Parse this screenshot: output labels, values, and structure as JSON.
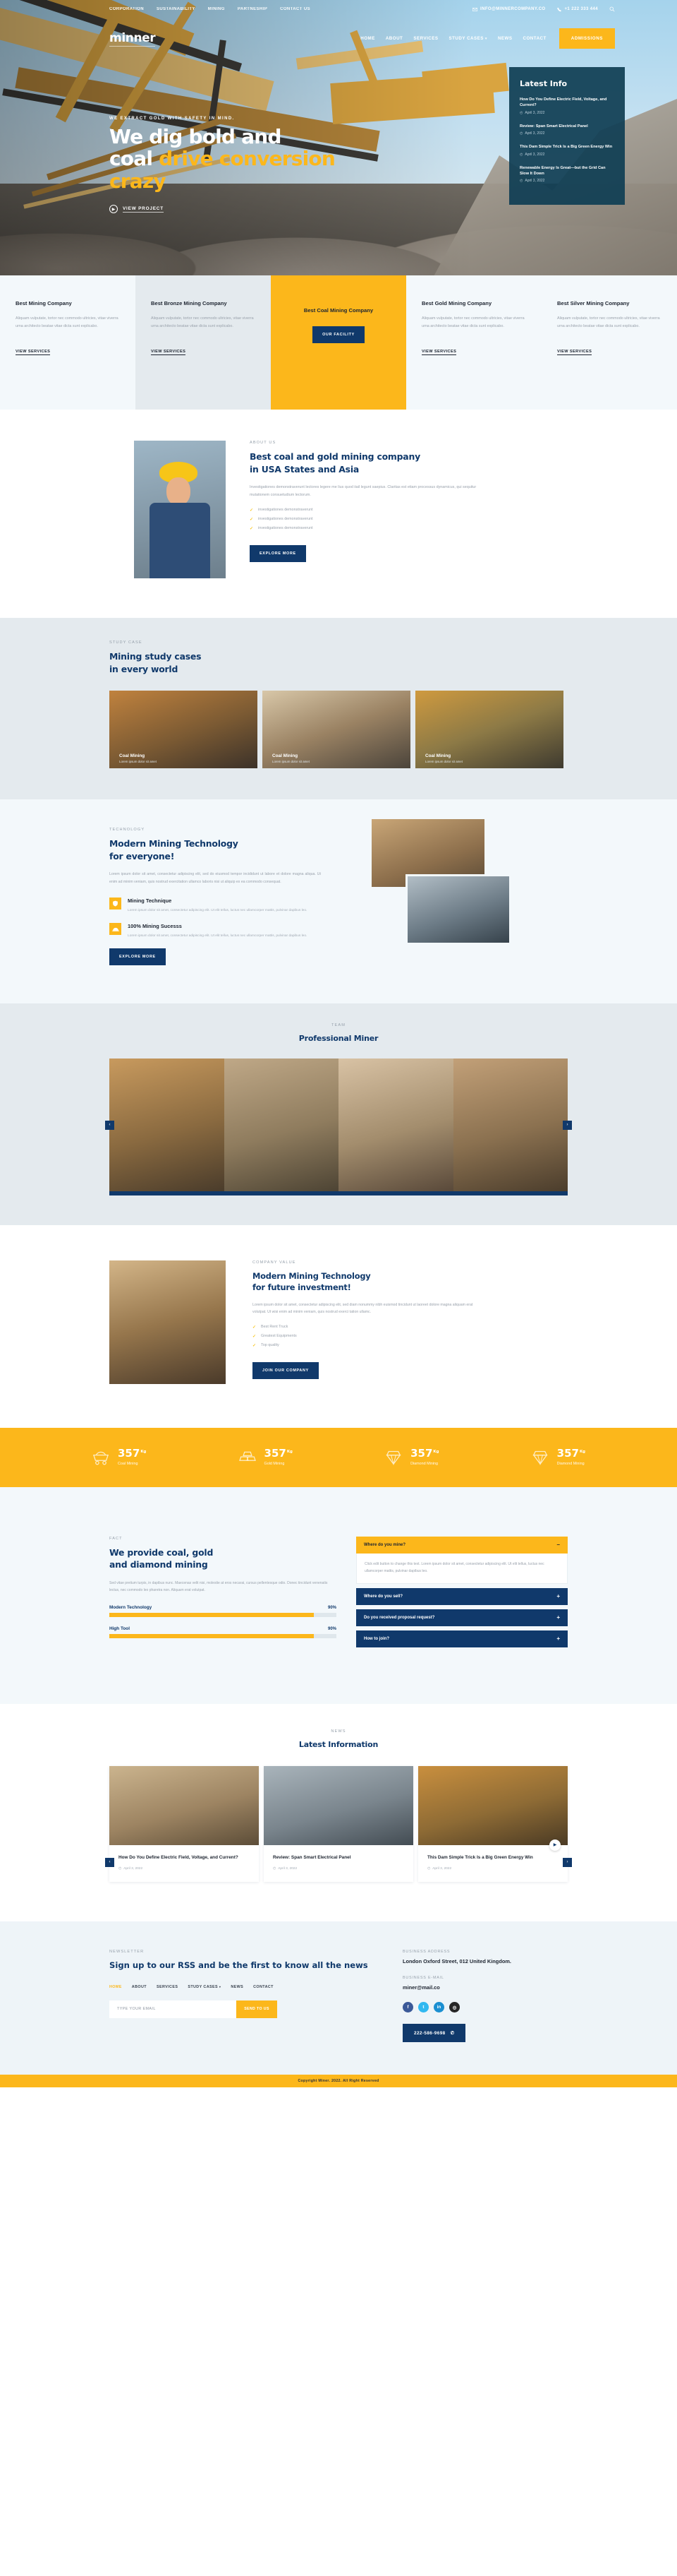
{
  "brand": {
    "name": "minner"
  },
  "topbar": {
    "links": [
      "CORPORATION",
      "SUSTAINABILITY",
      "MINING",
      "PARTNESHIP",
      "CONTACT US"
    ],
    "email": "INFO@MINNERCOMPANY.CO",
    "phone": "+1 222 333 444",
    "search_icon": "search-icon",
    "mail_icon": "mail-icon",
    "phone_icon": "phone-icon"
  },
  "nav": {
    "items": [
      "HOME",
      "ABOUT",
      "SERVICES",
      "STUDY CASES",
      "NEWS",
      "CONTACT"
    ],
    "dropdown_index": 3,
    "cta": "ADMISSIONS"
  },
  "hero": {
    "eyebrow": "WE EXTRACT GOLD WITH SAFETY IN MIND.",
    "title_1": "We dig bold and",
    "title_2a": "coal ",
    "title_2b": "drive conversion",
    "title_3": "crazy",
    "cta": "VIEW PROJECT"
  },
  "latest_info": {
    "title": "Latest Info",
    "items": [
      {
        "title": "How Do You Define Electric Field, Voltage, and Current?",
        "date": "April 3, 2022"
      },
      {
        "title": "Review: Span Smart Electrical Panel",
        "date": "April 3, 2022"
      },
      {
        "title": "This Dam Simple Trick Is a Big Green Energy Win",
        "date": "April 3, 2022"
      },
      {
        "title": "Renewable Energy Is Great—but the Grid Can Slow It Down",
        "date": "April 3, 2022"
      }
    ]
  },
  "service_cards": {
    "body": "Aliquam vulputate, tortor nec commodo ultricies, vitae viverra urna architecto beatae vitae dicta sunt explicabo.",
    "link": "VIEW SERVICES",
    "items": [
      {
        "title": "Best Mining Company"
      },
      {
        "title": "Best Bronze Mining Company"
      },
      {
        "title": "Best Coal Mining Company",
        "button": "OUR FACILITY"
      },
      {
        "title": "Best Gold Mining Company"
      },
      {
        "title": "Best Silver Mining Company"
      }
    ]
  },
  "about": {
    "eyebrow": "ABOUT US",
    "title_1": "Best coal and gold mining company",
    "title_2": "in USA States and Asia",
    "body": "Investigationes demonstraverunt lectores legere me lius quod iiail legunt saepius. Claritas est etiam processus dynamicus, qui sequitur mutationem consuetudium lectorum.",
    "bullets": [
      "investigationes demonstraverunt",
      "investigationes demonstraverunt",
      "investigationes demonstraverunt"
    ],
    "button": "EXPLORE MORE"
  },
  "study": {
    "eyebrow": "STUDY CASE",
    "title_1": "Mining study cases",
    "title_2": "in every world",
    "cases": [
      {
        "caption": "Coal Mining",
        "sub": "Lorem ipsum dolor sit amet"
      },
      {
        "caption": "Coal Mining",
        "sub": "Lorem ipsum dolor sit amet"
      },
      {
        "caption": "Coal Mining",
        "sub": "Lorem ipsum dolor sit amet"
      }
    ]
  },
  "technology": {
    "eyebrow": "TECHNOLOGY",
    "title_1": "Modern Mining Technology",
    "title_2": "for everyone!",
    "body": "Lorem ipsum dolor sit amet, consectetur adipiscing elit, sed do eiusmod tempor incididunt ut labore et dolore magna aliqua. Ut enim ad minim veniam, quis nostrud exercitation ullamco laboris nisi ut aliquip ex ea commodo consequat.",
    "features": [
      {
        "icon": "shield-icon",
        "title": "Mining Technique",
        "body": "Lorem ipsum dolor sit amet, consectetur adipiscing elit. Ut elit tellus, luctus nec ullamcorper mattis, pulvinar dapibus leo."
      },
      {
        "icon": "helmet-icon",
        "title": "100% Mining Sucesss",
        "body": "Lorem ipsum dolor sit amet, consectetur adipiscing elit. Ut elit tellus, luctus nec ullamcorper mattis, pulvinar dapibus leo."
      }
    ],
    "button": "EXPLORE MORE"
  },
  "team": {
    "eyebrow": "TEAM",
    "title": "Professional Miner",
    "prev_icon": "chevron-left-icon",
    "next_icon": "chevron-right-icon"
  },
  "company_value": {
    "eyebrow": "COMPANY VALUE",
    "title_1": "Modern Mining Technology",
    "title_2": "for future investment!",
    "body": "Lorem ipsum dolor sit amet, consectetur adipiscing elit, sed diam nonummy nibh euismod tincidunt ut laoreet dolore magna aliquam erat volutpat. Ut wisi enim ad minim veniam, quis nostrud exerci tation ullamc.",
    "bullets": [
      "Best Rent Truck",
      "Greatest Equipments",
      "Top quality"
    ],
    "button": "JOIN OUR COMPANY"
  },
  "chart_data": {
    "type": "bar",
    "title": "Mining output counters",
    "unit": "Kg",
    "categories": [
      "Coal Mining",
      "Gold Mining",
      "Diamond Mining",
      "Diamond Mining"
    ],
    "values": [
      357,
      357,
      357,
      357
    ],
    "icons": [
      "mine-cart-icon",
      "gold-bars-icon",
      "diamond-icon",
      "diamond-icon"
    ],
    "ylabel": "Kg",
    "xlabel": "",
    "grid": false,
    "legend": "none"
  },
  "stats": {
    "items": [
      {
        "icon": "mine-cart-icon",
        "value": "357",
        "unit": "Kg",
        "label": "Coal Mining"
      },
      {
        "icon": "gold-bars-icon",
        "value": "357",
        "unit": "Kg",
        "label": "Gold Mining"
      },
      {
        "icon": "diamond-icon",
        "value": "357",
        "unit": "Kg",
        "label": "Diamond Mining"
      },
      {
        "icon": "diamond-icon",
        "value": "357",
        "unit": "Kg",
        "label": "Diamond Mining"
      }
    ]
  },
  "fact": {
    "eyebrow": "FACT",
    "title_1": "We provide coal, gold",
    "title_2": "and diamond mining",
    "body": "Sed vitae pretium turpis, in dapibus nunc. Maecenas velit nisi, molestie at eros necarai, cursus pellentesque odio. Donec tincidunt venenatis lectus, nec commodo leo pharetra non. Aliquam erat volutpat.",
    "bars": [
      {
        "name": "Modern Technology",
        "percent": "90%",
        "value": 90
      },
      {
        "name": "High Tool",
        "percent": "90%",
        "value": 90
      }
    ]
  },
  "faq": {
    "items": [
      {
        "q": "Where do you mine?",
        "open": true,
        "sign": "–",
        "a": "Click edit button to change this text. Lorem ipsum dolor sit amet, consectetur adipiscing elit. Ut elit tellus, luctus nec ullamcorper mattis, pulvinar dapibus leo."
      },
      {
        "q": "Where do you sell?",
        "open": false,
        "sign": "+"
      },
      {
        "q": "Do you received proposal request?",
        "open": false,
        "sign": "+"
      },
      {
        "q": "How to join?",
        "open": false,
        "sign": "+"
      }
    ]
  },
  "news": {
    "eyebrow": "NEWS",
    "title": "Latest Information",
    "prev_icon": "chevron-left-icon",
    "next_icon": "chevron-right-icon",
    "items": [
      {
        "title": "How Do You Define Electric Field, Voltage, and Current?",
        "date": "April 3, 2022"
      },
      {
        "title": "Review: Span Smart Electrical Panel",
        "date": "April 3, 2022"
      },
      {
        "title": "This Dam Simple Trick Is a Big Green Energy Win",
        "date": "April 3, 2022"
      }
    ]
  },
  "footer": {
    "eyebrow": "NEWSLETTER",
    "headline": "Sign up to our RSS and be the first to know all the news",
    "nav": [
      "HOME",
      "ABOUT",
      "SERVICES",
      "STUDY CASES",
      "NEWS",
      "CONTACT"
    ],
    "email_placeholder": "TYPE YOUR EMAIL",
    "email_value": "",
    "submit": "SEND TO US",
    "address_label": "BUSINESS ADDRESS",
    "address_value": "London Oxford Street, 012 United Kingdom.",
    "email_label": "BUSINESS E-MAIL",
    "email_val": "miner@mail.co",
    "socials": [
      "facebook-icon",
      "twitter-icon",
      "linkedin-icon",
      "instagram-icon"
    ],
    "phone": "222-586-9698",
    "phone_icon": "whatsapp-icon",
    "copyright": "Copyright Miner. 2022. All Right Reserved"
  }
}
